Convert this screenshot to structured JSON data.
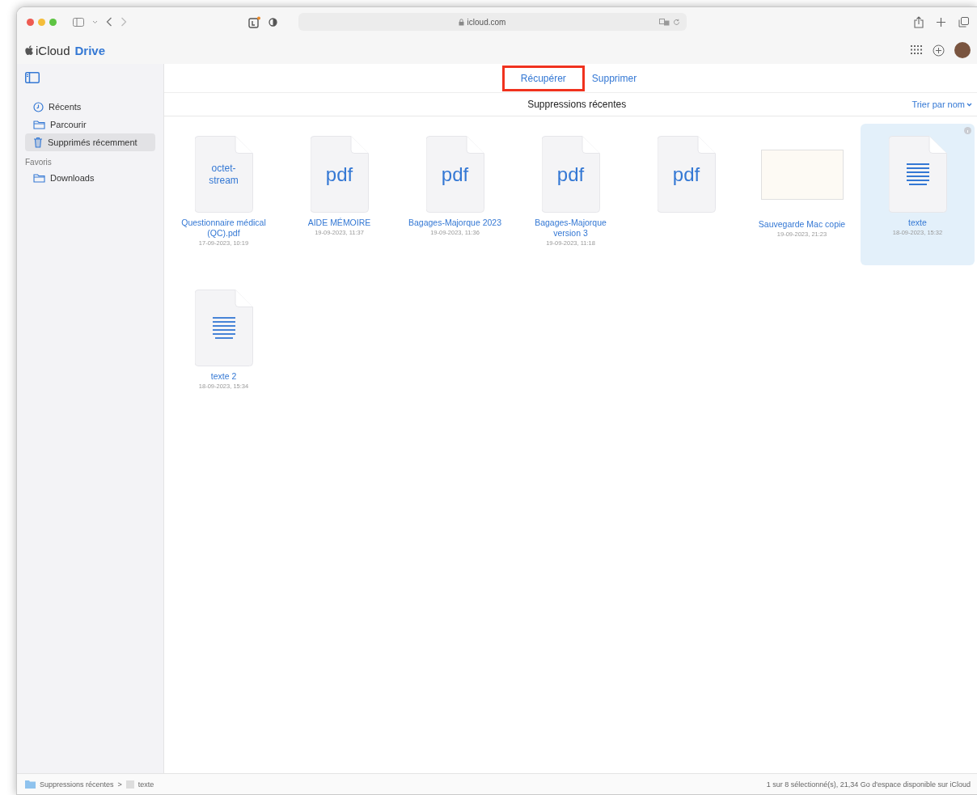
{
  "browser": {
    "address": "icloud.com"
  },
  "app": {
    "brand": "iCloud",
    "product": "Drive"
  },
  "sidebar": {
    "sections": [
      {
        "items": [
          {
            "label": "Récents",
            "kind": "clock",
            "selected": false
          },
          {
            "label": "Parcourir",
            "kind": "folder",
            "selected": false
          },
          {
            "label": "Supprimés récemment",
            "kind": "trash",
            "selected": true
          }
        ]
      },
      {
        "heading": "Favoris",
        "items": [
          {
            "label": "Downloads",
            "kind": "folder",
            "selected": false
          }
        ]
      }
    ]
  },
  "actions": [
    {
      "label": "Récupérer",
      "highlighted": true
    },
    {
      "label": "Supprimer",
      "highlighted": false
    }
  ],
  "title": "Suppressions récentes",
  "sort": "Trier par nom",
  "files": [
    {
      "kind": "generic",
      "type_label": "octet-stream",
      "name": "Questionnaire médical (QC).pdf",
      "date": "17-09-2023, 10:19",
      "selected": false
    },
    {
      "kind": "generic",
      "type_label": "pdf",
      "name": "AIDE MÉMOIRE",
      "date": "19-09-2023, 11:37",
      "selected": false
    },
    {
      "kind": "generic",
      "type_label": "pdf",
      "name": "Bagages-Majorque 2023",
      "date": "19-09-2023, 11:36",
      "selected": false
    },
    {
      "kind": "generic",
      "type_label": "pdf",
      "name": "Bagages-Majorque version 3",
      "date": "19-09-2023, 11:18",
      "selected": false
    },
    {
      "kind": "generic",
      "type_label": "pdf",
      "selected": false
    },
    {
      "kind": "preview",
      "name": "Sauvegarde Mac copie",
      "date": "19-09-2023, 21:23",
      "selected": false
    },
    {
      "kind": "text",
      "name": "texte",
      "date": "18-09-2023, 15:32",
      "selected": true
    },
    {
      "kind": "text",
      "name": "texte 2",
      "date": "18-09-2023, 15:34",
      "selected": false
    }
  ],
  "status_bar": {
    "breadcrumb": [
      "Suppressions récentes",
      "texte"
    ],
    "separator": ">",
    "info": "1 sur 8 sélectionné(s), 21,34 Go d'espace disponible sur iCloud"
  }
}
